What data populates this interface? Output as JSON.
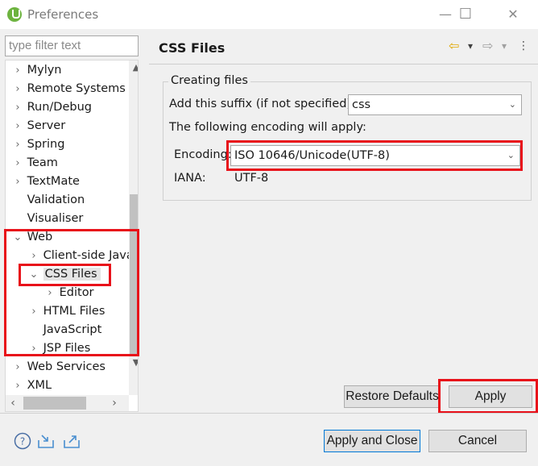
{
  "window": {
    "title": "Preferences",
    "minimize_glyph": "—",
    "maximize_glyph": "☐",
    "close_glyph": "✕"
  },
  "filter": {
    "placeholder": "type filter text"
  },
  "tree": [
    {
      "label": "Mylyn",
      "chevron": "›"
    },
    {
      "label": "Remote Systems",
      "chevron": "›"
    },
    {
      "label": "Run/Debug",
      "chevron": "›"
    },
    {
      "label": "Server",
      "chevron": "›"
    },
    {
      "label": "Spring",
      "chevron": "›"
    },
    {
      "label": "Team",
      "chevron": "›"
    },
    {
      "label": "TextMate",
      "chevron": "›"
    },
    {
      "label": "Validation",
      "chevron": ""
    },
    {
      "label": "Visualiser",
      "chevron": ""
    },
    {
      "label": "Web",
      "chevron": "⌄"
    },
    {
      "label": "Client-side JavaScript",
      "chevron": "›"
    },
    {
      "label": "CSS Files",
      "chevron": "⌄"
    },
    {
      "label": "Editor",
      "chevron": "›"
    },
    {
      "label": "HTML Files",
      "chevron": "›"
    },
    {
      "label": "JavaScript",
      "chevron": ""
    },
    {
      "label": "JSP Files",
      "chevron": "›"
    },
    {
      "label": "Web Services",
      "chevron": "›"
    },
    {
      "label": "XML",
      "chevron": "›"
    }
  ],
  "page": {
    "title": "CSS Files",
    "group_title": "Creating files",
    "suffix_label": "Add this suffix (if not specified):",
    "suffix_value": "css",
    "encoding_note": "The following encoding will apply:",
    "encoding_label": "Encoding:",
    "encoding_value": "ISO 10646/Unicode(UTF-8)",
    "iana_label": "IANA:",
    "iana_value": "UTF-8"
  },
  "buttons": {
    "restore_defaults": "Restore Defaults",
    "apply": "Apply",
    "apply_and_close": "Apply and Close",
    "cancel": "Cancel"
  },
  "icons": {
    "back": "⇦",
    "forward": "⇨",
    "dropdown": "▾",
    "help": "?"
  },
  "colors": {
    "highlight_red": "#e8111a",
    "accent_blue": "#0078d7",
    "back_arrow": "#e0a800"
  }
}
